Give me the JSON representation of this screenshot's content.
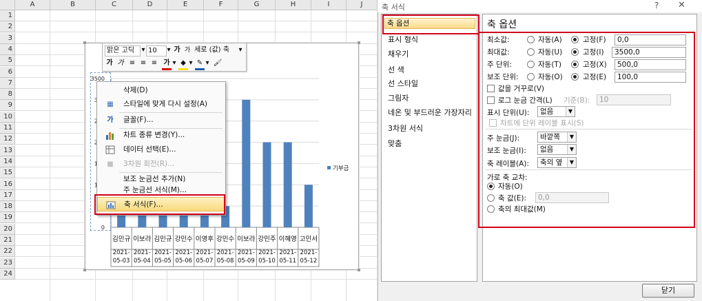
{
  "sheet": {
    "columns": [
      "A",
      "B",
      "C",
      "D",
      "E",
      "F",
      "G",
      "H",
      "I",
      "J"
    ],
    "rows": [
      "1",
      "2",
      "3",
      "4",
      "5",
      "6",
      "7",
      "8",
      "9",
      "10",
      "11",
      "12",
      "13",
      "14",
      "15",
      "16",
      "17",
      "18",
      "19",
      "20",
      "21",
      "22",
      "23",
      "24"
    ]
  },
  "mini_toolbar": {
    "font_name": "맑은 고딕",
    "font_size": "10",
    "grow_font": "가",
    "shrink_font": "가",
    "element_select": "세로 (값) 축",
    "bold": "가",
    "italic": "가",
    "font_color": "가"
  },
  "chart": {
    "y_tick_labels": [
      "3500",
      "300",
      "250",
      "200",
      "150",
      "100",
      "50",
      "0"
    ],
    "legend": "기부금",
    "series_color": "#4f81bd",
    "chart_data": {
      "type": "bar",
      "categories": [
        "김민규 2021-05-03",
        "이보라 2021-05-04",
        "김민규 2021-05-05",
        "강민수 2021-05-06",
        "이영후 2021-05-07",
        "강민수 2021-05-08",
        "이보라 2021-05-09",
        "강민주 2021-05-10",
        "이혜영 2021-05-11",
        "고민서 2021-05-12"
      ],
      "names": [
        "김민규",
        "이보라",
        "김민규",
        "강민수",
        "이영후",
        "강민수",
        "이보라",
        "강민주",
        "이혜영",
        "고민서"
      ],
      "dates_top": [
        "2021-",
        "2021-",
        "2021-",
        "2021-",
        "2021-",
        "2021-",
        "2021-",
        "2021-",
        "2021-",
        "2021-"
      ],
      "dates_bottom": [
        "05-03",
        "05-04",
        "05-05",
        "05-06",
        "05-07",
        "05-08",
        "05-09",
        "05-10",
        "05-11",
        "05-12"
      ],
      "series": [
        {
          "name": "기부금",
          "values": [
            50,
            50,
            50,
            50,
            50,
            50,
            300,
            200,
            200,
            100
          ]
        }
      ],
      "ylim": [
        0,
        350
      ]
    }
  },
  "context_menu": {
    "items": [
      {
        "label": "삭제(D)",
        "icon": "delete-icon",
        "disabled": false
      },
      {
        "label": "스타일에 맞게 다시 설정(A)",
        "icon": "reset-style-icon",
        "disabled": false
      },
      {
        "label": "글꼴(F)...",
        "icon": "font-icon",
        "disabled": false
      },
      {
        "label": "차트 종류 변경(Y)...",
        "icon": "chart-type-icon",
        "disabled": false
      },
      {
        "label": "데이터 선택(E)...",
        "icon": "select-data-icon",
        "disabled": false
      },
      {
        "label": "3차원 회전(R)...",
        "icon": "rotation-icon",
        "disabled": true
      },
      {
        "label": "보조 눈금선 추가(N)",
        "icon": "",
        "disabled": false
      },
      {
        "label": "주 눈금선 서식(M)...",
        "icon": "",
        "disabled": false
      },
      {
        "label": "축 서식(F)...",
        "icon": "format-axis-icon",
        "disabled": false
      }
    ]
  },
  "dialog": {
    "title": "축 서식",
    "help": "?",
    "close": "✕",
    "nav": [
      "축 옵션",
      "표시 형식",
      "채우기",
      "선 색",
      "선 스타일",
      "그림자",
      "네온 및 부드러운 가장자리",
      "3차원 서식",
      "맞춤"
    ],
    "section_title": "축 옵션",
    "min_label": "최소값:",
    "max_label": "최대값:",
    "major_unit_label": "주 단위:",
    "minor_unit_label": "보조 단위:",
    "auto_a": "자동(A)",
    "fixed_f": "고정(F)",
    "auto_u": "자동(U)",
    "fixed_i": "고정(I)",
    "auto_t": "자동(T)",
    "fixed_x": "고정(X)",
    "auto_o": "자동(O)",
    "fixed_e": "고정(E)",
    "min_value": "0,0",
    "max_value": "3500,0",
    "major_value": "500,0",
    "minor_value": "100,0",
    "reverse_label": "값을 거꾸로(V)",
    "log_label": "로그 눈금 간격(L)",
    "base_label": "기준(B):",
    "base_value": "10",
    "display_units_label": "표시 단위(U):",
    "display_units_value": "없음",
    "show_units_label": "차트에 단위 레이블 표시(S)",
    "major_tick_label": "주 눈금(J):",
    "major_tick_value": "바깥쪽",
    "minor_tick_label": "보조 눈금(I):",
    "minor_tick_value": "없음",
    "axis_labels_label": "축 레이블(A):",
    "axis_labels_value": "축의 옆",
    "crosses_title": "가로 축 교차:",
    "crosses_auto": "자동(O)",
    "crosses_value_label": "축 값(E):",
    "crosses_value": "0,0",
    "crosses_max": "축의 최대값(M)",
    "close_button": "닫기"
  }
}
